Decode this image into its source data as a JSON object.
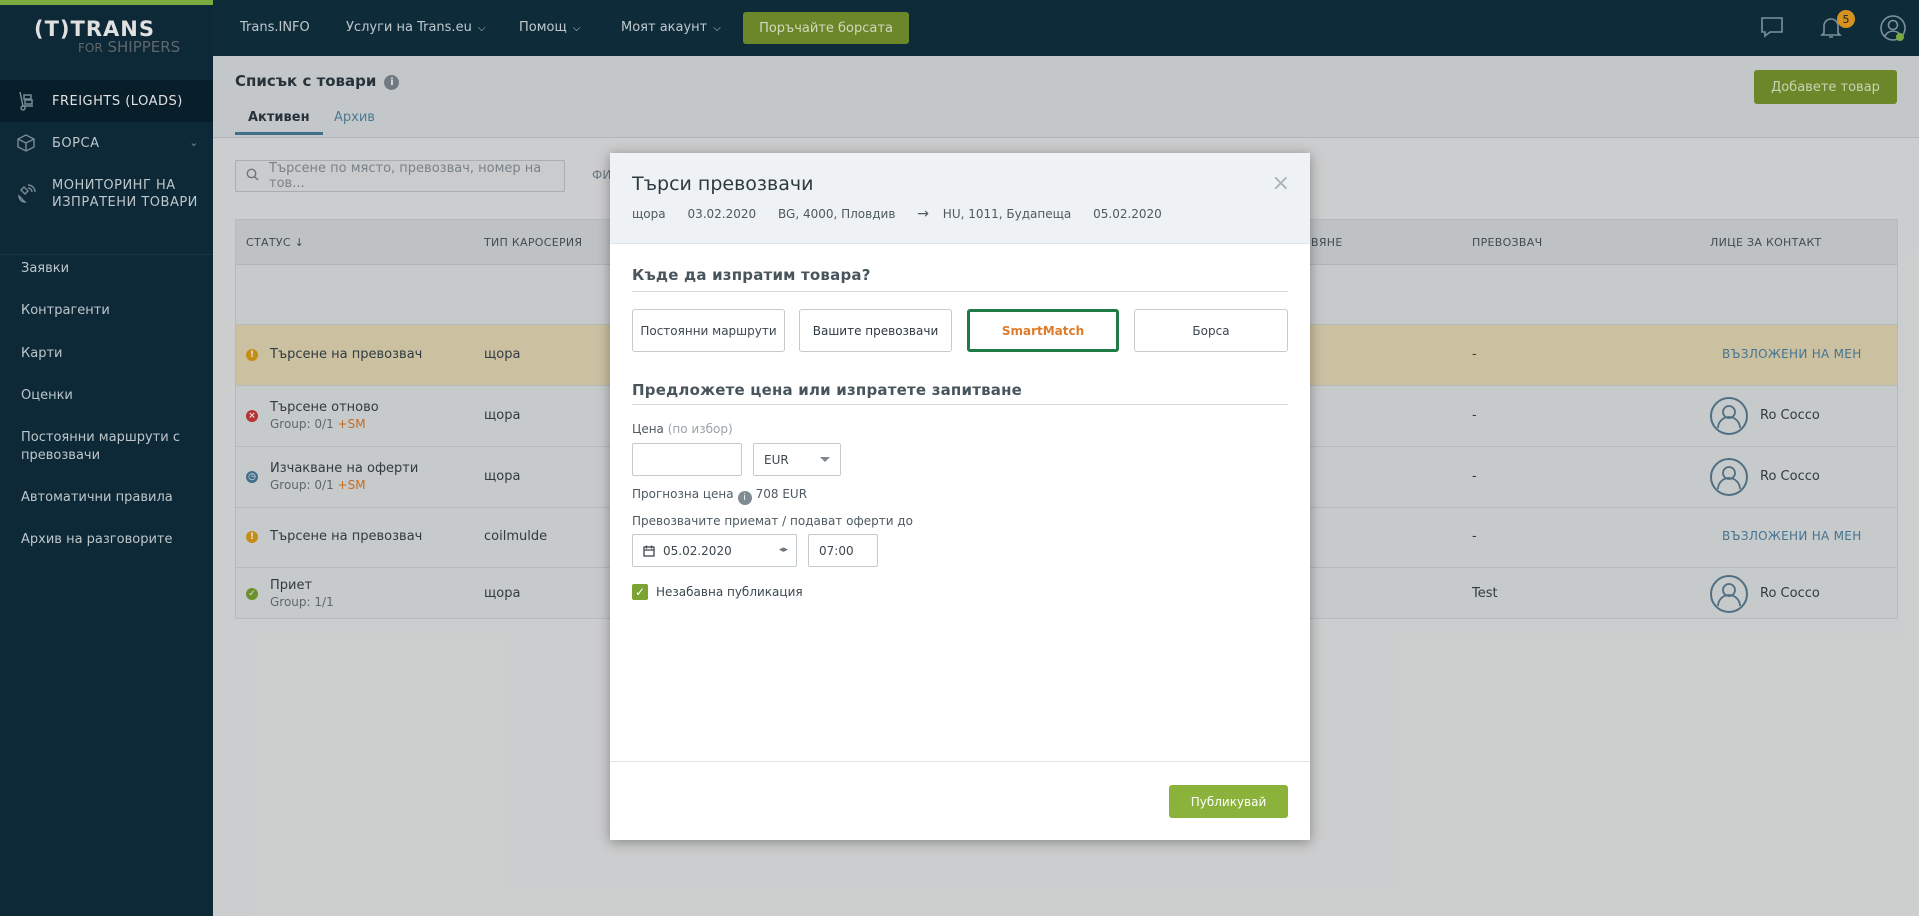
{
  "sidebar": {
    "logo_main": "(T)TRANS",
    "logo_for": "FOR",
    "logo_shippers": "SHIPPERS",
    "main_items": [
      {
        "label": "FREIGHTS (LOADS)"
      },
      {
        "label": "БОРСА"
      },
      {
        "label": "МОНИТОРИНГ НА ИЗПРАТЕНИ ТОВАРИ"
      }
    ],
    "items": [
      {
        "label": "Заявки"
      },
      {
        "label": "Контрагенти"
      },
      {
        "label": "Карти"
      },
      {
        "label": "Оценки"
      },
      {
        "label": "Постоянни маршрути с превозвачи"
      },
      {
        "label": "Автоматични правила"
      },
      {
        "label": "Архив на разговорите"
      }
    ]
  },
  "topbar": {
    "trans_info": "Trans.INFO",
    "services": "Услуги на Trans.eu",
    "help": "Помощ",
    "account": "Моят акаунт",
    "exchange_button": "Поръчайте борсата",
    "notifications_count": "5"
  },
  "page": {
    "title": "Списък с товари",
    "tab_active": "Активен",
    "tab_archive": "Архив",
    "add_button": "Добавете товар",
    "search_placeholder": "Търсене по място, превозвач, номер на тов...",
    "filter_cut": "ФИ"
  },
  "table": {
    "headers": {
      "status": "СТАТУС ↓",
      "body_type": "ТИП КАРОСЕРИЯ",
      "cut": "ВЯНЕ",
      "carrier": "ПРЕВОЗВАЧ",
      "contact": "ЛИЦЕ ЗА КОНТАКТ"
    },
    "rows": [
      {
        "status": "Търсене на превозвач",
        "group": "",
        "sm": "",
        "body": "щора",
        "carrier": "-",
        "contact": "ВЪЗЛОЖЕНИ НА МЕН"
      },
      {
        "status": "Търсене отново",
        "group": "Group: 0/1",
        "sm": "+SM",
        "body": "щора",
        "carrier": "-",
        "contact": "Ro Cocco"
      },
      {
        "status": "Изчакване на оферти",
        "group": "Group: 0/1",
        "sm": "+SM",
        "body": "щора",
        "carrier": "-",
        "contact": "Ro Cocco"
      },
      {
        "status": "Търсене на превозвач",
        "group": "",
        "sm": "",
        "body": "coilmulde",
        "carrier": "-",
        "contact": "ВЪЗЛОЖЕНИ НА МЕН"
      },
      {
        "status": "Приет",
        "group": "Group: 1/1",
        "sm": "",
        "body": "щора",
        "carrier": "Test",
        "contact": "Ro Cocco"
      }
    ]
  },
  "modal": {
    "title": "Търси превозвачи",
    "route": {
      "body": "щора",
      "date_from": "03.02.2020",
      "origin": "BG, 4000, Пловдив",
      "destination": "HU, 1011, Будапеща",
      "date_to": "05.02.2020"
    },
    "where_title": "Къде да изпратим товара?",
    "options": [
      {
        "label": "Постоянни маршрути"
      },
      {
        "label": "Вашите превозвачи"
      },
      {
        "label": "SmartMatch"
      },
      {
        "label": "Борса"
      }
    ],
    "price_title": "Предложете цена или изпратете запитване",
    "price_label": "Цена",
    "price_optional": "(по избор)",
    "price_value": "",
    "currency": "EUR",
    "forecast_label": "Прогнозна цена",
    "forecast_value": "708 EUR",
    "deadline_label": "Превозвачите приемат / подават оферти до",
    "date": "05.02.2020",
    "time": "07:00",
    "immediate_label": "Незабавна публикация",
    "publish_button": "Публикувай"
  }
}
